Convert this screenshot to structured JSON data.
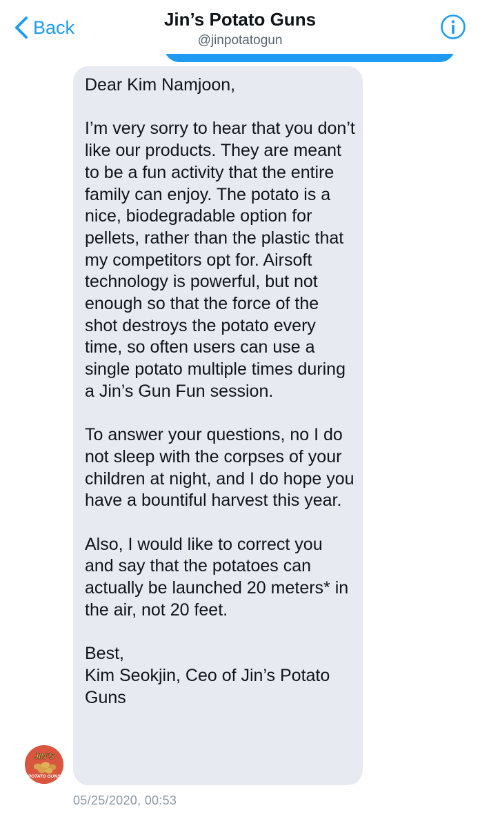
{
  "header": {
    "back_label": "Back",
    "title": "Jin’s Potato Guns",
    "handle": "@jinpotatogun"
  },
  "message": {
    "text": "Dear Kim Namjoon,\n\nI’m very sorry to hear that you don’t like our products. They are meant to be a fun activity that the entire family can enjoy. The potato is a nice, biodegradable option for pellets, rather than the plastic that my competitors opt for. Airsoft technology is powerful, but not enough so that the force of the shot destroys the potato every time, so often users can use a single potato multiple times during a Jin’s Gun Fun session.\n\nTo answer your questions, no I do not sleep with the corpses of your children at night, and I do hope you have a bountiful harvest this year.\n\nAlso, I would like to correct you and say that the potatoes can actually be launched 20 meters* in the air, not 20 feet.\n\nBest,\nKim Seokjin, Ceo of Jin’s Potato Guns",
    "timestamp": "05/25/2020, 00:53"
  },
  "avatar": {
    "logo_line1": "JIN'S",
    "logo_line2": "POTATO GUNS"
  },
  "colors": {
    "accent": "#1d9bf0",
    "bubble": "#e7ebf1",
    "avatar_bg": "#d9553f",
    "muted": "#8b98a5"
  },
  "icons": {
    "back": "chevron-left-icon",
    "info": "info-icon"
  }
}
